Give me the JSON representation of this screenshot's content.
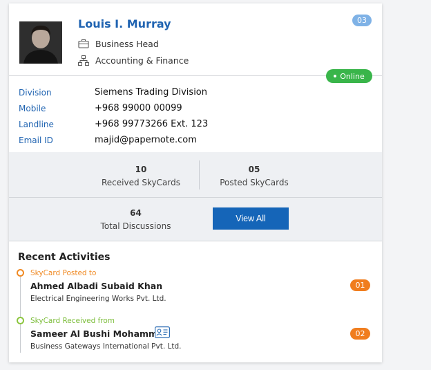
{
  "profile": {
    "name": "Louis I. Murray",
    "title": "Business Head",
    "department": "Accounting & Finance",
    "badge": "03",
    "status": "Online"
  },
  "info": [
    {
      "label": "Division",
      "value": "Siemens Trading Division"
    },
    {
      "label": "Mobile",
      "value": "+968 99000 00099"
    },
    {
      "label": "Landline",
      "value": "+968 99773266 Ext. 123"
    },
    {
      "label": "Email ID",
      "value": "majid@papernote.com"
    }
  ],
  "stats": {
    "received": {
      "value": "10",
      "label": "Received SkyCards"
    },
    "posted": {
      "value": "05",
      "label": "Posted SkyCards"
    },
    "discussions": {
      "value": "64",
      "label": "Total Discussions"
    },
    "view_all": "View All"
  },
  "activities": {
    "title": "Recent Activities",
    "items": [
      {
        "type": "SkyCard Posted to",
        "name": "Ahmed Albadi Subaid Khan",
        "company": "Electrical Engineering Works Pvt. Ltd.",
        "badge": "01"
      },
      {
        "type": "SkyCard Received from",
        "name": "Sameer Al Bushi Mohammed",
        "company": "Business Gateways International Pvt. Ltd.",
        "badge": "02"
      }
    ]
  },
  "colors": {
    "accent": "#1f63b1",
    "online": "#39b54a",
    "posted": "#f08a24",
    "received": "#7cbd3a",
    "badge": "#f07d1e"
  },
  "icons": [
    "briefcase-icon",
    "org-chart-icon",
    "contact-card-icon"
  ]
}
